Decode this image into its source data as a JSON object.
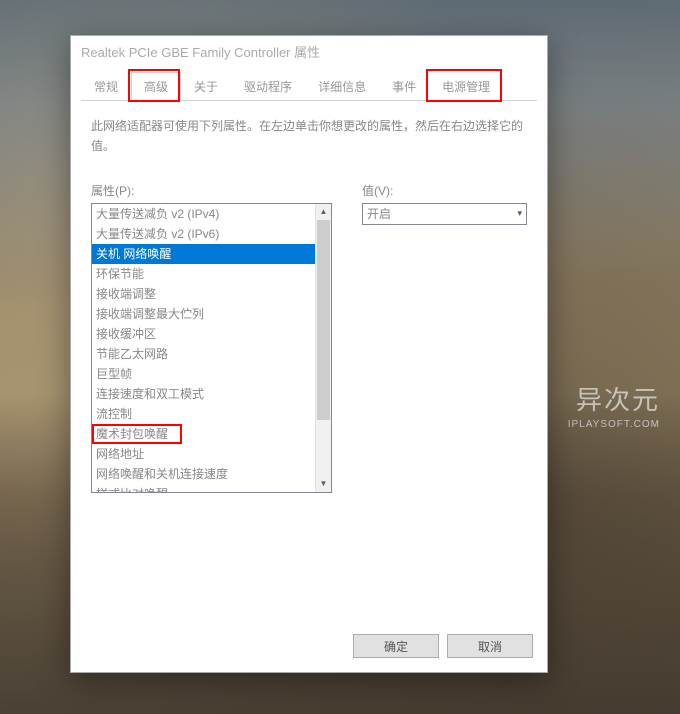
{
  "window": {
    "title": "Realtek PCIe GBE Family Controller 属性"
  },
  "tabs": [
    {
      "label": "常规"
    },
    {
      "label": "高级",
      "active": true,
      "highlighted": true
    },
    {
      "label": "关于"
    },
    {
      "label": "驱动程序"
    },
    {
      "label": "详细信息"
    },
    {
      "label": "事件"
    },
    {
      "label": "电源管理",
      "highlighted": true
    }
  ],
  "description": "此网络适配器可使用下列属性。在左边单击你想更改的属性，然后在右边选择它的值。",
  "property_label": "属性(P):",
  "value_label": "值(V):",
  "properties": [
    {
      "label": "大量传送减负 v2 (IPv4)"
    },
    {
      "label": "大量传送减负 v2 (IPv6)"
    },
    {
      "label": "关机 网络唤醒",
      "selected": true
    },
    {
      "label": "环保节能"
    },
    {
      "label": "接收端调整"
    },
    {
      "label": "接收端调整最大伫列"
    },
    {
      "label": "接收缓冲区"
    },
    {
      "label": "节能乙太网路"
    },
    {
      "label": "巨型帧"
    },
    {
      "label": "连接速度和双工模式"
    },
    {
      "label": "流控制"
    },
    {
      "label": "魔术封包唤醒",
      "highlighted": true
    },
    {
      "label": "网络地址"
    },
    {
      "label": "网络唤醒和关机连接速度"
    },
    {
      "label": "样式比对唤醒"
    }
  ],
  "value_selected": "开启",
  "buttons": {
    "ok": "确定",
    "cancel": "取消"
  },
  "watermark": {
    "main": "异次元",
    "sub": "IPLAYSOFT.COM"
  }
}
